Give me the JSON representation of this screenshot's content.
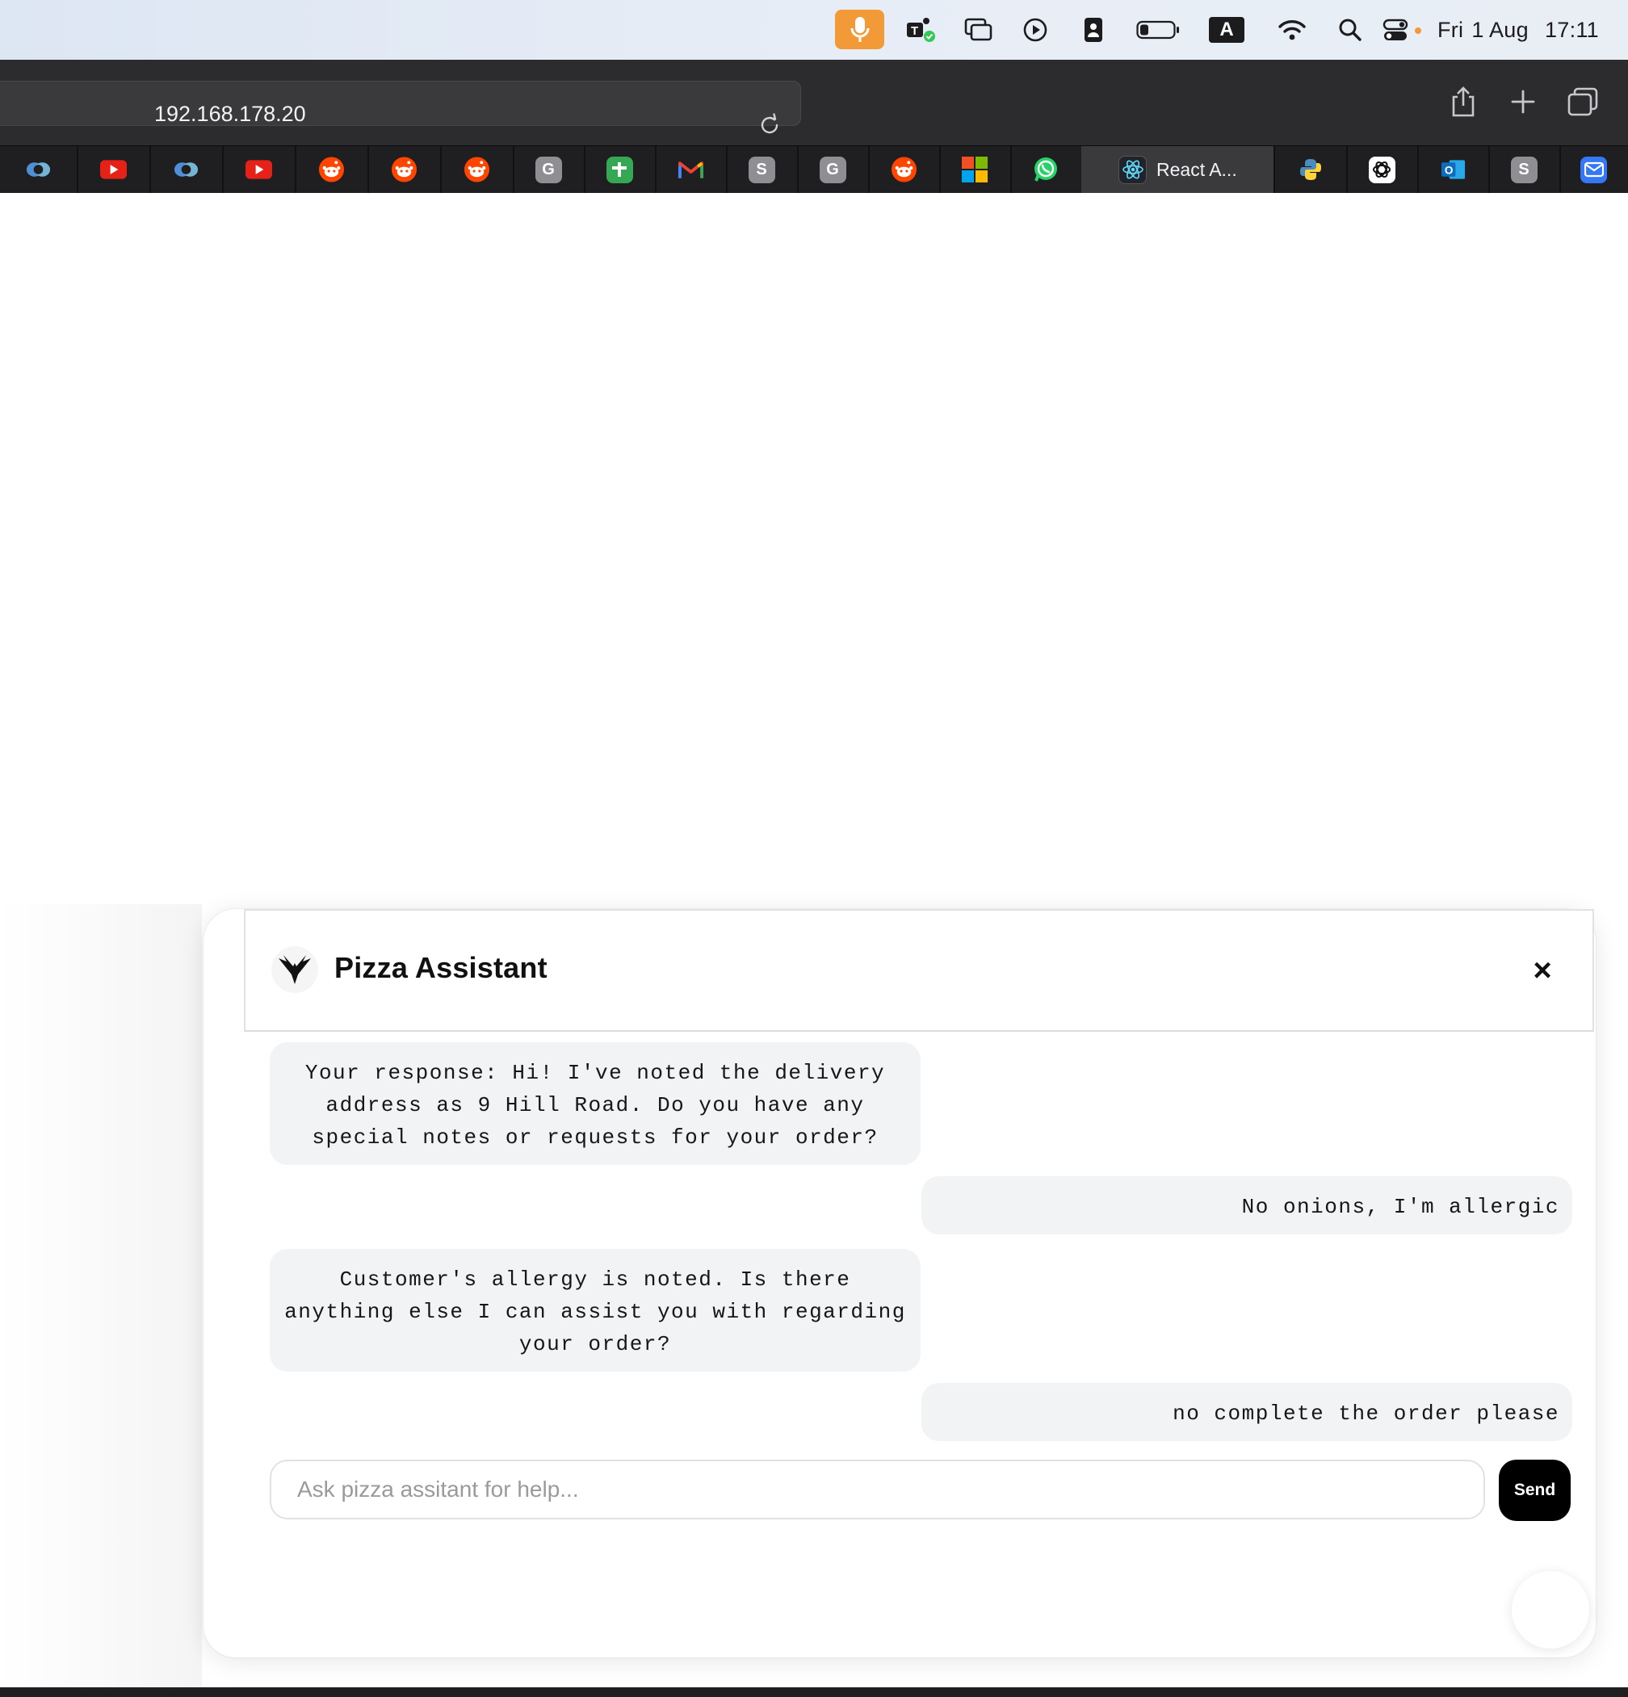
{
  "menubar": {
    "day": "Fri",
    "date": "1 Aug",
    "time": "17:11",
    "icons": [
      "microphone-icon",
      "teams-icon",
      "window-icon",
      "play-icon",
      "contact-icon",
      "battery-icon",
      "keyboard-input-a-icon",
      "wifi-icon",
      "search-icon",
      "control-center-icon"
    ],
    "input_letter": "A"
  },
  "browser": {
    "url": "192.168.178.20",
    "tabs": [
      {
        "icon": "copilot-icon"
      },
      {
        "icon": "youtube-icon"
      },
      {
        "icon": "copilot-icon"
      },
      {
        "icon": "youtube-icon"
      },
      {
        "icon": "reddit-icon"
      },
      {
        "icon": "reddit-icon"
      },
      {
        "icon": "reddit-icon"
      },
      {
        "icon": "g-icon",
        "letter": "G"
      },
      {
        "icon": "sheets-plus-icon"
      },
      {
        "icon": "gmail-icon"
      },
      {
        "icon": "s-icon",
        "letter": "S"
      },
      {
        "icon": "g-icon",
        "letter": "G"
      },
      {
        "icon": "reddit-icon"
      },
      {
        "icon": "microsoft-icon"
      },
      {
        "icon": "whatsapp-icon"
      },
      {
        "icon": "react-icon",
        "label": "React A..."
      },
      {
        "icon": "python-icon"
      },
      {
        "icon": "chatgpt-icon"
      },
      {
        "icon": "outlook-icon"
      },
      {
        "icon": "s-icon",
        "letter": "S"
      },
      {
        "icon": "mail-icon"
      }
    ]
  },
  "chat": {
    "title": "Pizza Assistant",
    "close_label": "×",
    "messages": [
      {
        "role": "bot",
        "text": "Your response: Hi! I've noted the delivery address as 9 Hill Road. Do you have any special notes or requests for your order?"
      },
      {
        "role": "user",
        "text": "No onions, I'm allergic"
      },
      {
        "role": "bot",
        "text": "Customer's allergy is noted. Is there anything else I can assist you with regarding your order?"
      },
      {
        "role": "user",
        "text": "no complete the order please"
      }
    ],
    "input_placeholder": "Ask pizza assitant for help...",
    "input_value": "",
    "send_label": "Send"
  },
  "colors": {
    "mic_accent": "#f29a38",
    "toolbar": "#2c2c2e",
    "bubble": "#f2f3f5",
    "send_button": "#000000"
  }
}
